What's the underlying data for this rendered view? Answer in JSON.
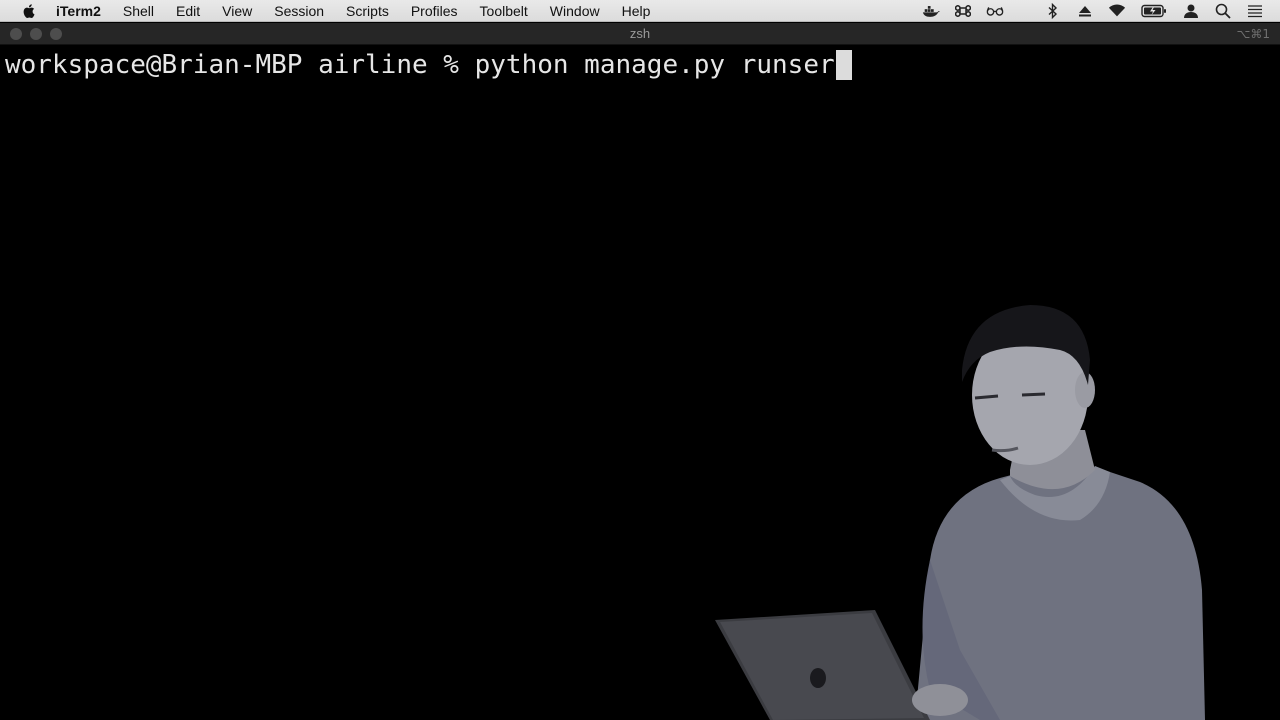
{
  "menubar": {
    "app_name": "iTerm2",
    "items": [
      "Shell",
      "Edit",
      "View",
      "Session",
      "Scripts",
      "Profiles",
      "Toolbelt",
      "Window",
      "Help"
    ],
    "status_icons": [
      "docker-icon",
      "command-icon",
      "glasses-icon",
      "bluetooth-icon",
      "eject-icon",
      "wifi-icon",
      "battery-icon",
      "user-icon",
      "search-icon",
      "list-icon"
    ]
  },
  "window": {
    "title": "zsh",
    "shortcut": "⌥⌘1"
  },
  "terminal": {
    "prompt": "workspace@Brian-MBP airline % ",
    "command": "python manage.py runser"
  },
  "colors": {
    "background": "#000000",
    "text": "#e6e6e6",
    "titlebar": "#262626",
    "menubar": "#e3e3e3"
  }
}
